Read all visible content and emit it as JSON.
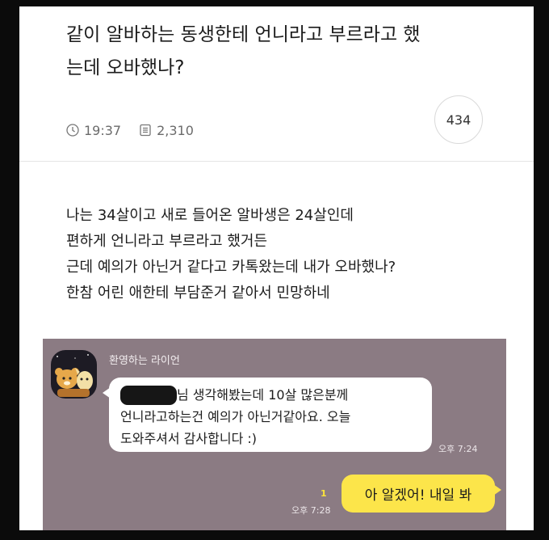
{
  "post": {
    "title_lines": [
      "같이 알바하는 동생한테 언니라고 부르라고 했",
      "는데 오바했나?"
    ],
    "time": "19:37",
    "views": "2,310",
    "comment_count": "434",
    "icons": {
      "time": "clock-icon",
      "views": "document-list-icon"
    },
    "body_lines": [
      "나는 34살이고 새로 들어온 알바생은 24살인데",
      "편하게 언니라고 부르라고 했거든",
      "근데 예의가 아닌거 같다고 카톡왔는데 내가 오바했나?",
      "한참 어린 애한테 부담준거 같아서 민망하네"
    ]
  },
  "chat": {
    "sender_name": "환영하는 라이언",
    "incoming_lines": [
      "님 생각해봤는데 10살 많은분께",
      "언니라고하는건 예의가 아닌거같아요. 오늘",
      "도와주셔서 감사합니다 :)"
    ],
    "incoming_time": "오후 7:24",
    "outgoing_text": "아 알겠어! 내일 봐",
    "outgoing_unread": "1",
    "outgoing_time": "오후 7:28",
    "colors": {
      "chat_bg": "#8b7b83",
      "outgoing_bubble": "#fce54a",
      "incoming_bubble": "#ffffff"
    }
  }
}
